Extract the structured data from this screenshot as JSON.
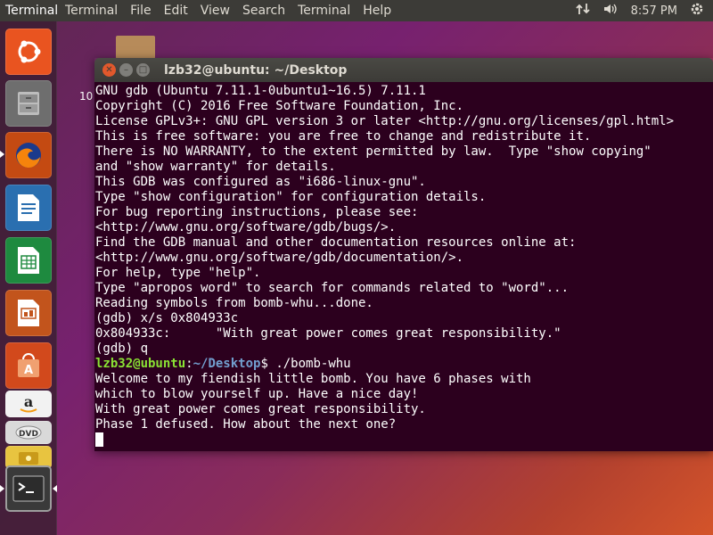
{
  "topbar": {
    "app_name": "Terminal",
    "menus": [
      "Terminal",
      "File",
      "Edit",
      "View",
      "Search",
      "Terminal",
      "Help"
    ],
    "clock": "8:57 PM"
  },
  "launcher": {
    "items": [
      {
        "name": "ubuntu-dash",
        "color": "#e95420"
      },
      {
        "name": "files",
        "color": "#7a7a7a"
      },
      {
        "name": "firefox",
        "color": "#e66000"
      },
      {
        "name": "libreoffice-writer",
        "color": "#2a6fb0"
      },
      {
        "name": "libreoffice-calc",
        "color": "#1e8a3f"
      },
      {
        "name": "libreoffice-impress",
        "color": "#c2541c"
      },
      {
        "name": "ubuntu-software",
        "color": "#e06a2c"
      },
      {
        "name": "amazon",
        "color": "#f2f2f2"
      },
      {
        "name": "dvd",
        "color": "#cccccc"
      },
      {
        "name": "terminal",
        "color": "#2e2e2e"
      }
    ]
  },
  "desktop": {
    "partial_label": "10"
  },
  "window": {
    "title": "lzb32@ubuntu: ~/Desktop"
  },
  "terminal": {
    "lines": [
      "GNU gdb (Ubuntu 7.11.1-0ubuntu1~16.5) 7.11.1",
      "Copyright (C) 2016 Free Software Foundation, Inc.",
      "License GPLv3+: GNU GPL version 3 or later <http://gnu.org/licenses/gpl.html>",
      "This is free software: you are free to change and redistribute it.",
      "There is NO WARRANTY, to the extent permitted by law.  Type \"show copying\"",
      "and \"show warranty\" for details.",
      "This GDB was configured as \"i686-linux-gnu\".",
      "Type \"show configuration\" for configuration details.",
      "For bug reporting instructions, please see:",
      "<http://www.gnu.org/software/gdb/bugs/>.",
      "Find the GDB manual and other documentation resources online at:",
      "<http://www.gnu.org/software/gdb/documentation/>.",
      "For help, type \"help\".",
      "Type \"apropos word\" to search for commands related to \"word\"...",
      "Reading symbols from bomb-whu...done.",
      "(gdb) x/s 0x804933c",
      "0x804933c:      \"With great power comes great responsibility.\"",
      "(gdb) q"
    ],
    "prompt_user": "lzb32@ubuntu",
    "prompt_sep": ":",
    "prompt_path": "~/Desktop",
    "prompt_end": "$ ",
    "command": "./bomb-whu",
    "output": [
      "Welcome to my fiendish little bomb. You have 6 phases with",
      "which to blow yourself up. Have a nice day!",
      "With great power comes great responsibility.",
      "Phase 1 defused. How about the next one?"
    ]
  }
}
